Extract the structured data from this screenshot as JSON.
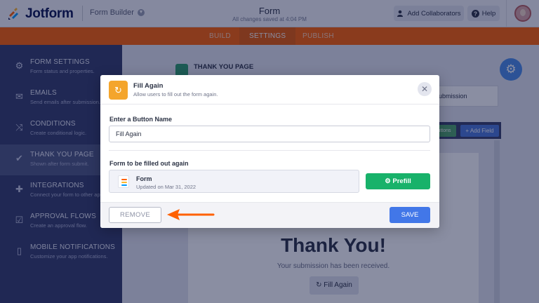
{
  "header": {
    "brand": "Jotform",
    "builder_label": "Form Builder",
    "form_title": "Form",
    "saved_status": "All changes saved at 4:04 PM",
    "collab_label": "Add Collaborators",
    "help_label": "Help",
    "icons": [
      "jotform-logo-icon",
      "chevron-down-icon",
      "user-icon",
      "question-icon",
      "avatar"
    ]
  },
  "nav": {
    "tabs": [
      "BUILD",
      "SETTINGS",
      "PUBLISH"
    ],
    "active": "SETTINGS"
  },
  "sidebar": {
    "items": [
      {
        "title": "FORM SETTINGS",
        "desc": "Form status and properties.",
        "icon": "gear-icon"
      },
      {
        "title": "EMAILS",
        "desc": "Send emails after submission.",
        "icon": "envelope-icon"
      },
      {
        "title": "CONDITIONS",
        "desc": "Create conditional logic.",
        "icon": "shuffle-icon"
      },
      {
        "title": "THANK YOU PAGE",
        "desc": "Shown after form submit.",
        "icon": "check-circle-icon"
      },
      {
        "title": "INTEGRATIONS",
        "desc": "Connect your form to other ap",
        "icon": "puzzle-icon"
      },
      {
        "title": "APPROVAL FLOWS",
        "desc": "Create an approval flow.",
        "icon": "approval-icon"
      },
      {
        "title": "MOBILE NOTIFICATIONS",
        "desc": "Customize your app notifications.",
        "icon": "mobile-icon"
      }
    ],
    "active_index": 3
  },
  "background": {
    "section_title": "THANK YOU PAGE",
    "submission_label": "ubmission",
    "buttons_label": "uttons",
    "add_field": "+ Add Field",
    "thank_you": "Thank You!",
    "received": "Your submission has been received.",
    "fill_again": "Fill Again"
  },
  "modal": {
    "title": "Fill Again",
    "subtitle": "Allow users to fill out the form again.",
    "name_label": "Enter a Button Name",
    "name_value": "Fill Again",
    "form_label": "Form to be filled out again",
    "form_name": "Form",
    "form_updated": "Updated on Mar 31, 2022",
    "prefill": "Prefill",
    "remove": "REMOVE",
    "save": "SAVE"
  },
  "colors": {
    "brand_orange": "#ff6100",
    "sidebar": "#343c6a",
    "prefill_green": "#18b26a",
    "save_blue": "#4277e8",
    "annotation_arrow": "#ff6100"
  }
}
